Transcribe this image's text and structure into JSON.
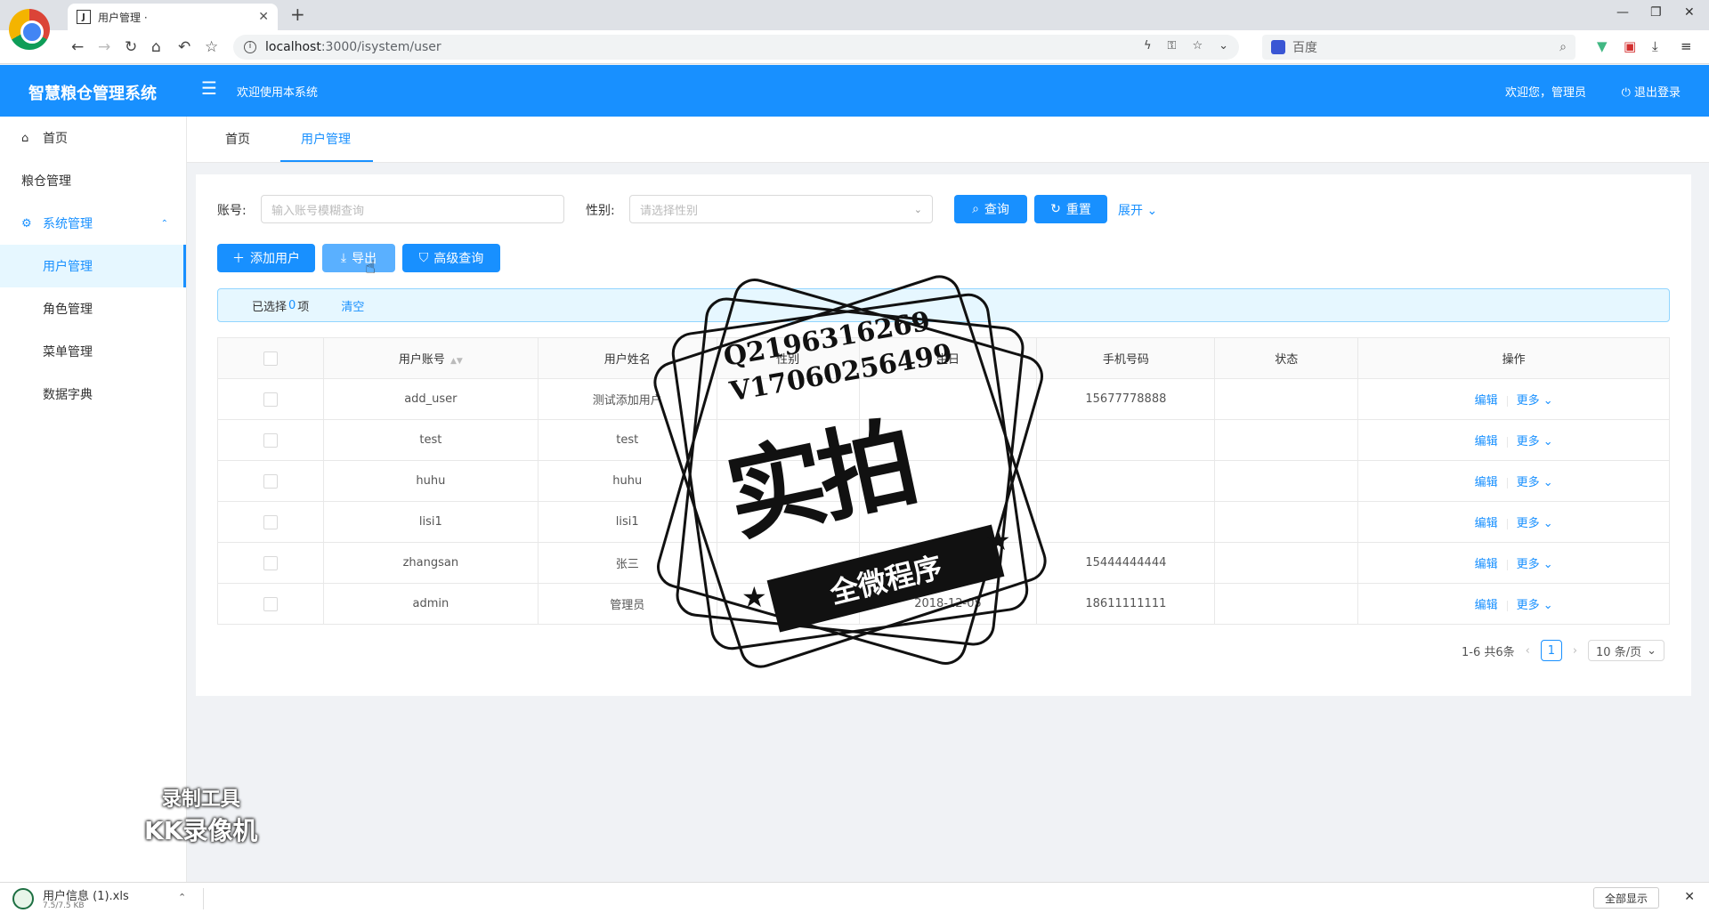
{
  "browser": {
    "tab_title": "用户管理 ·",
    "tab_favicon": "J",
    "url_host": "localhost",
    "url_path": ":3000/isystem/user",
    "search_placeholder": "百度"
  },
  "header": {
    "app_title": "智慧粮仓管理系统",
    "welcome": "欢迎使用本系统",
    "greeting": "欢迎您，管理员",
    "logout": "退出登录"
  },
  "sidebar": {
    "items": [
      {
        "label": "首页"
      },
      {
        "label": "粮仓管理"
      },
      {
        "label": "系统管理"
      },
      {
        "label": "用户管理"
      },
      {
        "label": "角色管理"
      },
      {
        "label": "菜单管理"
      },
      {
        "label": "数据字典"
      }
    ]
  },
  "pagetabs": [
    "首页",
    "用户管理"
  ],
  "search": {
    "account_label": "账号:",
    "account_placeholder": "输入账号模糊查询",
    "gender_label": "性别:",
    "gender_placeholder": "请选择性别",
    "query": "查询",
    "reset": "重置",
    "expand": "展开"
  },
  "actions": {
    "add": "添加用户",
    "export": "导出",
    "advanced": "高级查询"
  },
  "selection": {
    "prefix": "已选择",
    "count": "0",
    "suffix": "项",
    "clear": "清空"
  },
  "table": {
    "headers": [
      "用户账号",
      "用户姓名",
      "性别",
      "生日",
      "手机号码",
      "状态",
      "操作"
    ],
    "rows": [
      {
        "account": "add_user",
        "name": "测试添加用户",
        "gender": "",
        "birthday": "",
        "phone": "15677778888",
        "status": ""
      },
      {
        "account": "test",
        "name": "test",
        "gender": "",
        "birthday": "",
        "phone": "",
        "status": ""
      },
      {
        "account": "huhu",
        "name": "huhu",
        "gender": "",
        "birthday": "",
        "phone": "",
        "status": ""
      },
      {
        "account": "lisi1",
        "name": "lisi1",
        "gender": "",
        "birthday": "",
        "phone": "",
        "status": ""
      },
      {
        "account": "zhangsan",
        "name": "张三",
        "gender": "",
        "birthday": "",
        "phone": "15444444444",
        "status": ""
      },
      {
        "account": "admin",
        "name": "管理员",
        "gender": "",
        "birthday": "2018-12-05",
        "phone": "18611111111",
        "status": ""
      }
    ],
    "edit": "编辑",
    "more": "更多"
  },
  "pagination": {
    "summary": "1-6 共6条",
    "page": "1",
    "size": "10 条/页"
  },
  "watermark": {
    "line1": "Q2196316269",
    "line2": "V17060256499",
    "big": "实拍",
    "ribbon": "全微程序",
    "recorder1": "录制工具",
    "recorder2": "KK录像机"
  },
  "download": {
    "file": "用户信息 (1).xls",
    "size": "7.5/7.5 KB",
    "show_all": "全部显示"
  }
}
